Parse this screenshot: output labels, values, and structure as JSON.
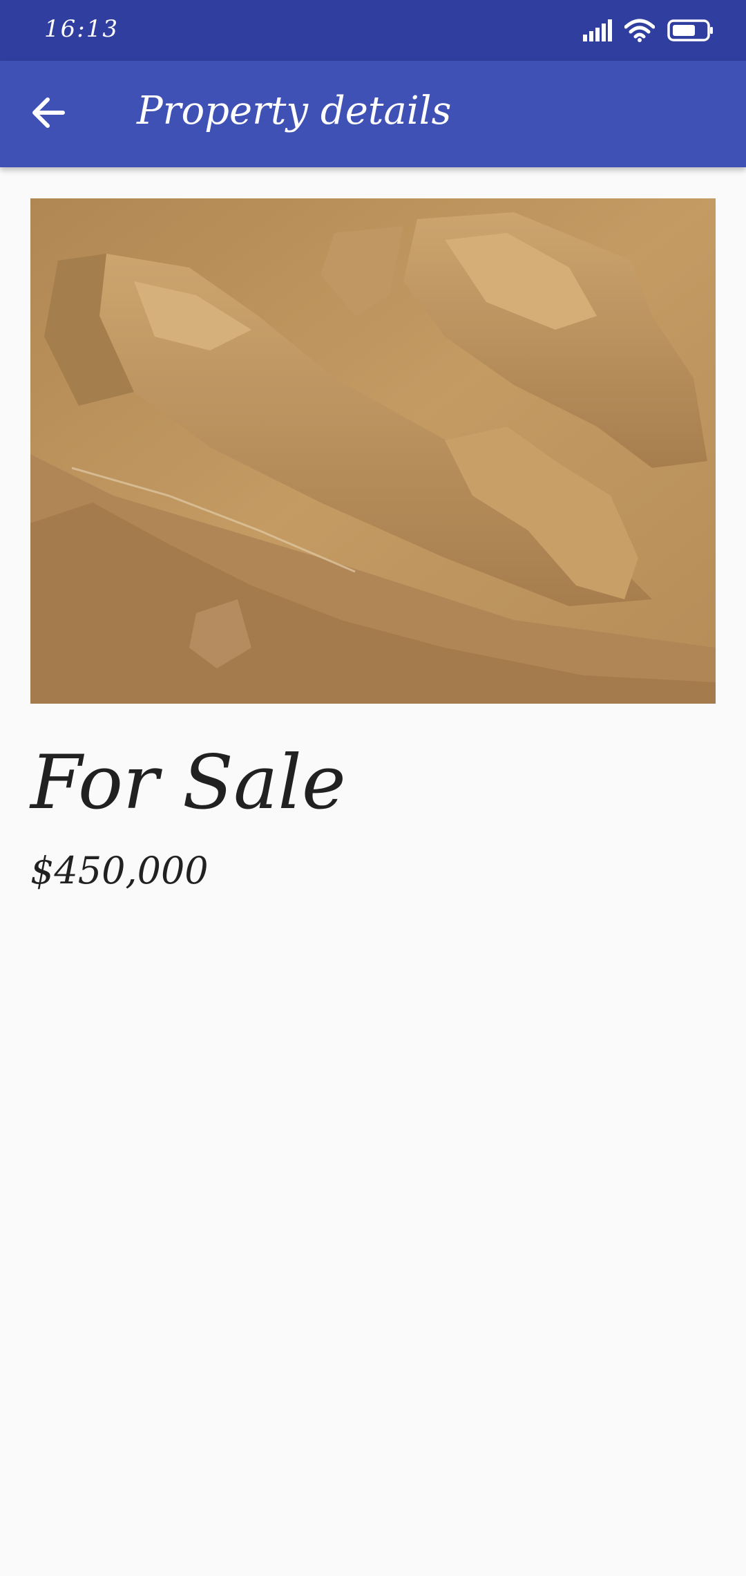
{
  "status_bar": {
    "time": "16:13",
    "icons": [
      "signal-icon",
      "wifi-icon",
      "battery-icon"
    ]
  },
  "app_bar": {
    "title": "Property details",
    "back_icon": "arrow-back-icon"
  },
  "listing": {
    "status": "For Sale",
    "price": "$450,000"
  },
  "colors": {
    "status_bar": "#303f9f",
    "app_bar": "#3f51b5",
    "background": "#fafafa",
    "text": "#212121"
  }
}
